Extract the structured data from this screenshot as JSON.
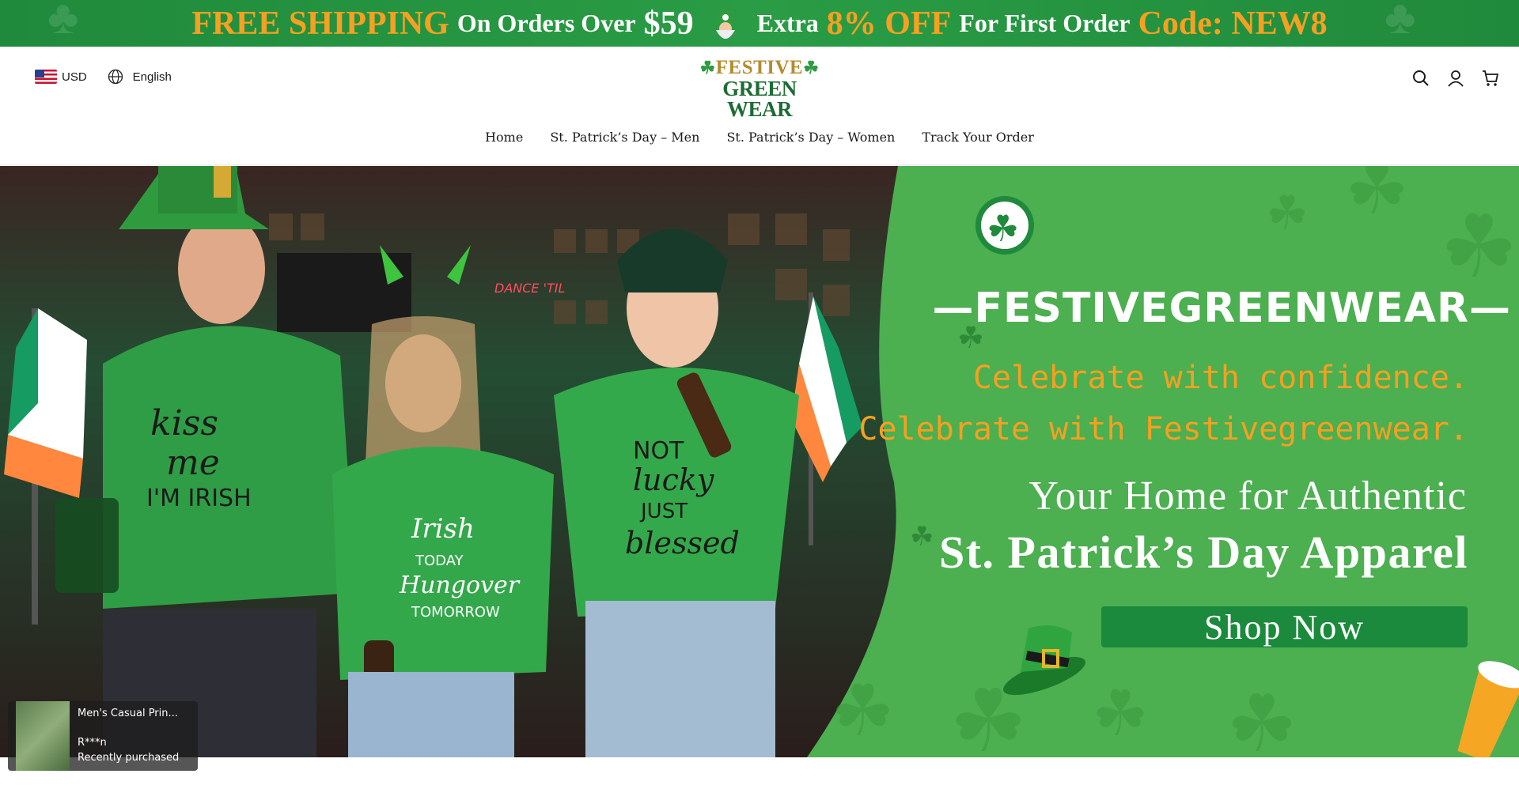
{
  "promo": {
    "free_shipping": "FREE SHIPPING",
    "on_orders_over": "On Orders Over",
    "threshold": "$59",
    "extra": "Extra",
    "discount": "8% OFF",
    "for_first_order": "For First Order",
    "code": "Code: NEW8"
  },
  "header": {
    "currency": "USD",
    "language": "English",
    "logo_line1": "FESTIVE",
    "logo_line2": "GREEN WEAR"
  },
  "nav": {
    "items": [
      {
        "label": "Home"
      },
      {
        "label": "St. Patrick’s Day – Men"
      },
      {
        "label": "St. Patrick’s Day – Women"
      },
      {
        "label": "Track Your Order"
      }
    ]
  },
  "hero": {
    "brand": "—FESTIVEGREENWEAR—",
    "script_line1": "Celebrate with confidence.",
    "script_line2": "Celebrate with Festivegreenwear.",
    "tagline1": "Your Home for Authentic",
    "tagline2": "St. Patrick’s Day Apparel",
    "shop_now": "Shop Now",
    "shirt_texts": [
      "Kiss me I'M IRISH",
      "Irish TODAY Hungover TOMORROW",
      "NOT lucky JUST blessed"
    ]
  },
  "popup": {
    "product_name": "Men's Casual Prin...",
    "buyer": "R***n",
    "status": "Recently purchased"
  },
  "colors": {
    "brand_green": "#1f8a3b",
    "panel_green": "#4caf50",
    "accent_orange": "#f5a021"
  },
  "icons": [
    "search-icon",
    "account-icon",
    "cart-icon",
    "globe-icon",
    "flag-us-icon"
  ]
}
